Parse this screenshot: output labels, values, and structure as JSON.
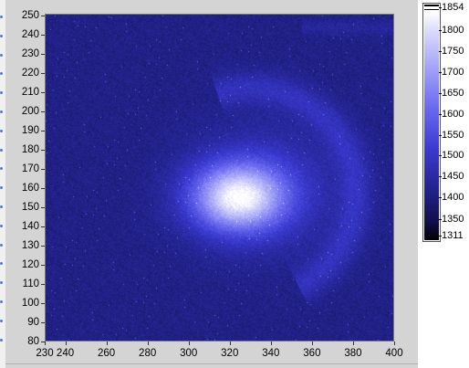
{
  "graph": {
    "y_axis": {
      "labels": [
        "250",
        "240",
        "230",
        "220",
        "210",
        "200",
        "190",
        "180",
        "170",
        "160",
        "150",
        "140",
        "130",
        "120",
        "110",
        "100",
        "90",
        "80"
      ],
      "min": 80,
      "max": 250
    },
    "x_axis": {
      "labels": [
        "230",
        "240",
        "260",
        "280",
        "300",
        "320",
        "340",
        "360",
        "380",
        "400"
      ],
      "min": 230,
      "max": 400
    },
    "colors": {
      "background_low": "#1c1c66",
      "mid": "#3a3ad2",
      "high": "#ffffff"
    }
  },
  "color_ramp": {
    "max_label": "1854",
    "labels": [
      "1800",
      "1750",
      "1700",
      "1650",
      "1600",
      "1550",
      "1500",
      "1450",
      "1400",
      "1350"
    ],
    "min_label": "1311"
  }
}
